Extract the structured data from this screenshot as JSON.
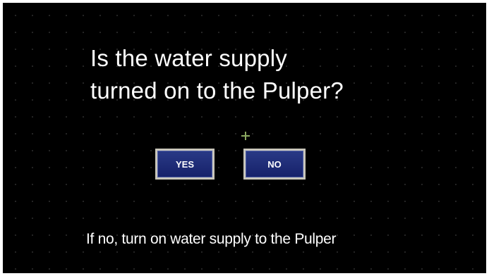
{
  "dialog": {
    "question_line1": "Is the water supply",
    "question_line2": "turned on to the Pulper?",
    "yes_label": "YES",
    "no_label": "NO",
    "hint": "If no, turn on water supply to the Pulper"
  },
  "colors": {
    "background": "#000000",
    "button_fill": "#1e2a78",
    "button_border": "#c9c6bb",
    "text": "#ffffff",
    "cursor": "#8aa860"
  },
  "icons": {
    "cursor": "crosshair-cursor-icon"
  }
}
